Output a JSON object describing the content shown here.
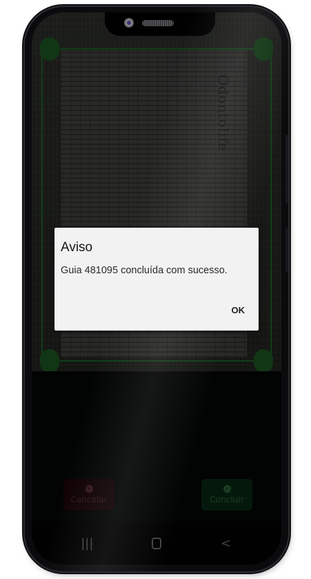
{
  "document_brand": "Odontolife",
  "dialog": {
    "title": "Aviso",
    "message": "Guia 481095 concluída com sucesso.",
    "ok_label": "OK"
  },
  "actions": {
    "cancel_label": "Cancelar",
    "confirm_label": "Concluir"
  },
  "navbar": {
    "recents_glyph": "|||",
    "back_glyph": "<"
  },
  "colors": {
    "frame_green": "#1f6b2a",
    "cancel_red": "#1d0507",
    "confirm_green": "#082c14"
  }
}
